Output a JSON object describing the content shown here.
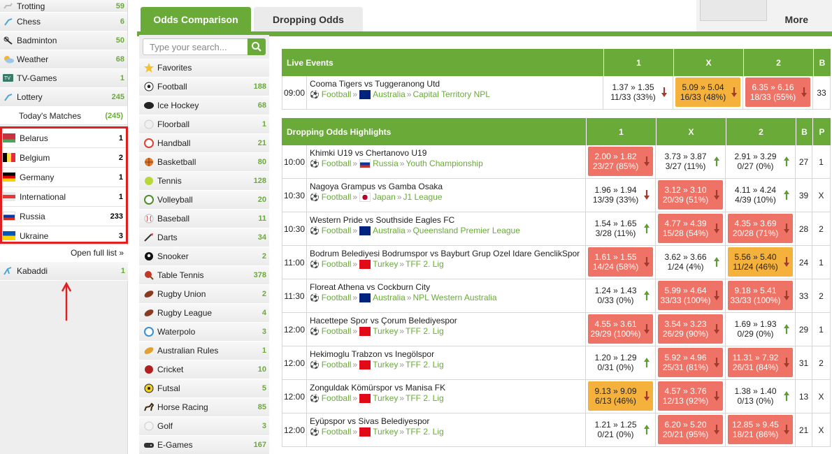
{
  "left_sidebar": {
    "items_top": [
      {
        "name": "Trotting",
        "count": "59",
        "icon": "horse-icon"
      },
      {
        "name": "Chess",
        "count": "6",
        "icon": "chess-icon"
      },
      {
        "name": "Badminton",
        "count": "50",
        "icon": "badminton-icon"
      },
      {
        "name": "Weather",
        "count": "68",
        "icon": "weather-icon"
      },
      {
        "name": "TV-Games",
        "count": "1",
        "icon": "tv-icon"
      },
      {
        "name": "Lottery",
        "count": "245",
        "icon": "lottery-icon"
      }
    ],
    "today": {
      "label": "Today's Matches",
      "count": "(245)"
    },
    "countries": [
      {
        "name": "Belarus",
        "count": "1"
      },
      {
        "name": "Belgium",
        "count": "2"
      },
      {
        "name": "Germany",
        "count": "1"
      },
      {
        "name": "International",
        "count": "1"
      },
      {
        "name": "Russia",
        "count": "233"
      },
      {
        "name": "Ukraine",
        "count": "3"
      }
    ],
    "open_full_list": "Open full list »",
    "kabaddi": {
      "name": "Kabaddi",
      "count": "1"
    }
  },
  "search": {
    "placeholder": "Type your search..."
  },
  "sports": [
    {
      "name": "Favorites",
      "count": ""
    },
    {
      "name": "Football",
      "count": "188"
    },
    {
      "name": "Ice Hockey",
      "count": "68"
    },
    {
      "name": "Floorball",
      "count": "1"
    },
    {
      "name": "Handball",
      "count": "21"
    },
    {
      "name": "Basketball",
      "count": "80"
    },
    {
      "name": "Tennis",
      "count": "128"
    },
    {
      "name": "Volleyball",
      "count": "20"
    },
    {
      "name": "Baseball",
      "count": "11"
    },
    {
      "name": "Darts",
      "count": "34"
    },
    {
      "name": "Snooker",
      "count": "2"
    },
    {
      "name": "Table Tennis",
      "count": "378"
    },
    {
      "name": "Rugby Union",
      "count": "2"
    },
    {
      "name": "Rugby League",
      "count": "4"
    },
    {
      "name": "Waterpolo",
      "count": "3"
    },
    {
      "name": "Australian Rules",
      "count": "1"
    },
    {
      "name": "Cricket",
      "count": "10"
    },
    {
      "name": "Futsal",
      "count": "5"
    },
    {
      "name": "Horse Racing",
      "count": "85"
    },
    {
      "name": "Golf",
      "count": "3"
    },
    {
      "name": "E-Games",
      "count": "167"
    }
  ],
  "tabs": {
    "odds_comparison": "Odds Comparison",
    "dropping_odds": "Dropping Odds",
    "more": "More"
  },
  "live": {
    "header": {
      "title": "Live Events",
      "c1": "1",
      "cx": "X",
      "c2": "2",
      "b": "B"
    },
    "rows": [
      {
        "time": "09:00",
        "match": "Cooma Tigers vs Tuggeranong Utd",
        "sport": "Football",
        "country": "Australia",
        "league": "Capital Territory NPL",
        "o1": {
          "odds": "1.37 » 1.35",
          "pct": "11/33 (33%)",
          "color": "none",
          "dir": "down"
        },
        "ox": {
          "odds": "5.09 » 5.04",
          "pct": "16/33 (48%)",
          "color": "orange",
          "dir": "down"
        },
        "o2": {
          "odds": "6.35 » 6.16",
          "pct": "18/33 (55%)",
          "color": "red",
          "dir": "down"
        },
        "b": "33"
      }
    ]
  },
  "dropping": {
    "header": {
      "title": "Dropping Odds Highlights",
      "c1": "1",
      "cx": "X",
      "c2": "2",
      "b": "B",
      "p": "P"
    },
    "rows": [
      {
        "time": "10:00",
        "match": "Khimki U19 vs Chertanovo U19",
        "sport": "Football",
        "country": "Russia",
        "league": "Youth Championship",
        "o1": {
          "odds": "2.00 » 1.82",
          "pct": "23/27 (85%)",
          "color": "red",
          "dir": "down"
        },
        "ox": {
          "odds": "3.73 » 3.87",
          "pct": "3/27 (11%)",
          "color": "none",
          "dir": "up"
        },
        "o2": {
          "odds": "2.91 » 3.29",
          "pct": "0/27 (0%)",
          "color": "none",
          "dir": "up"
        },
        "b": "27",
        "p": "1"
      },
      {
        "time": "10:30",
        "match": "Nagoya Grampus vs Gamba Osaka",
        "sport": "Football",
        "country": "Japan",
        "league": "J1 League",
        "o1": {
          "odds": "1.96 » 1.94",
          "pct": "13/39 (33%)",
          "color": "none",
          "dir": "down"
        },
        "ox": {
          "odds": "3.12 » 3.10",
          "pct": "20/39 (51%)",
          "color": "red",
          "dir": "down"
        },
        "o2": {
          "odds": "4.11 » 4.24",
          "pct": "4/39 (10%)",
          "color": "none",
          "dir": "up"
        },
        "b": "39",
        "p": "X"
      },
      {
        "time": "10:30",
        "match": "Western Pride vs Southside Eagles FC",
        "sport": "Football",
        "country": "Australia",
        "league": "Queensland Premier League",
        "o1": {
          "odds": "1.54 » 1.65",
          "pct": "3/28 (11%)",
          "color": "none",
          "dir": "up"
        },
        "ox": {
          "odds": "4.77 » 4.39",
          "pct": "15/28 (54%)",
          "color": "red",
          "dir": "down"
        },
        "o2": {
          "odds": "4.35 » 3.69",
          "pct": "20/28 (71%)",
          "color": "red",
          "dir": "down"
        },
        "b": "28",
        "p": "2"
      },
      {
        "time": "11:00",
        "match": "Bodrum Belediyesi Bodrumspor vs Bayburt Grup Ozel Idare GenclikSpor",
        "sport": "Football",
        "country": "Turkey",
        "league": "TFF 2. Lig",
        "o1": {
          "odds": "1.61 » 1.55",
          "pct": "14/24 (58%)",
          "color": "red",
          "dir": "down"
        },
        "ox": {
          "odds": "3.62 » 3.66",
          "pct": "1/24 (4%)",
          "color": "none",
          "dir": "up"
        },
        "o2": {
          "odds": "5.56 » 5.40",
          "pct": "11/24 (46%)",
          "color": "orange",
          "dir": "down"
        },
        "b": "24",
        "p": "1"
      },
      {
        "time": "11:30",
        "match": "Floreat Athena vs Cockburn City",
        "sport": "Football",
        "country": "Australia",
        "league": "NPL Western Australia",
        "o1": {
          "odds": "1.24 » 1.43",
          "pct": "0/33 (0%)",
          "color": "none",
          "dir": "up"
        },
        "ox": {
          "odds": "5.99 » 4.64",
          "pct": "33/33 (100%)",
          "color": "red",
          "dir": "down"
        },
        "o2": {
          "odds": "9.18 » 5.41",
          "pct": "33/33 (100%)",
          "color": "red",
          "dir": "down"
        },
        "b": "33",
        "p": "2"
      },
      {
        "time": "12:00",
        "match": "Hacettepe Spor vs Çorum Belediyespor",
        "sport": "Football",
        "country": "Turkey",
        "league": "TFF 2. Lig",
        "o1": {
          "odds": "4.55 » 3.61",
          "pct": "29/29 (100%)",
          "color": "red",
          "dir": "down"
        },
        "ox": {
          "odds": "3.54 » 3.23",
          "pct": "26/29 (90%)",
          "color": "red",
          "dir": "down"
        },
        "o2": {
          "odds": "1.69 » 1.93",
          "pct": "0/29 (0%)",
          "color": "none",
          "dir": "up"
        },
        "b": "29",
        "p": "1"
      },
      {
        "time": "12:00",
        "match": "Hekimoglu Trabzon vs Inegölspor",
        "sport": "Football",
        "country": "Turkey",
        "league": "TFF 2. Lig",
        "o1": {
          "odds": "1.20 » 1.29",
          "pct": "0/31 (0%)",
          "color": "none",
          "dir": "up"
        },
        "ox": {
          "odds": "5.92 » 4.96",
          "pct": "25/31 (81%)",
          "color": "red",
          "dir": "down"
        },
        "o2": {
          "odds": "11.31 » 7.92",
          "pct": "26/31 (84%)",
          "color": "red",
          "dir": "down"
        },
        "b": "31",
        "p": "2"
      },
      {
        "time": "12:00",
        "match": "Zonguldak Kömürspor vs Manisa FK",
        "sport": "Football",
        "country": "Turkey",
        "league": "TFF 2. Lig",
        "o1": {
          "odds": "9.13 » 9.09",
          "pct": "6/13 (46%)",
          "color": "orange",
          "dir": "down"
        },
        "ox": {
          "odds": "4.57 » 3.76",
          "pct": "12/13 (92%)",
          "color": "red",
          "dir": "down"
        },
        "o2": {
          "odds": "1.38 » 1.40",
          "pct": "0/13 (0%)",
          "color": "none",
          "dir": "up"
        },
        "b": "13",
        "p": "X"
      },
      {
        "time": "12:00",
        "match": "Eyüpspor vs Sivas Belediyespor",
        "sport": "Football",
        "country": "Turkey",
        "league": "TFF 2. Lig",
        "o1": {
          "odds": "1.21 » 1.25",
          "pct": "0/21 (0%)",
          "color": "none",
          "dir": "up"
        },
        "ox": {
          "odds": "6.20 » 5.20",
          "pct": "20/21 (95%)",
          "color": "red",
          "dir": "down"
        },
        "o2": {
          "odds": "12.85 » 9.45",
          "pct": "18/21 (86%)",
          "color": "red",
          "dir": "down"
        },
        "b": "21",
        "p": "X"
      }
    ]
  },
  "colors": {
    "accent_green": "#6aaa39",
    "drop_red": "#ee7366",
    "drop_orange": "#f4b13b",
    "arrow_down": "#a33a2e",
    "arrow_up": "#5e9e36",
    "highlight_border": "#e02020"
  }
}
